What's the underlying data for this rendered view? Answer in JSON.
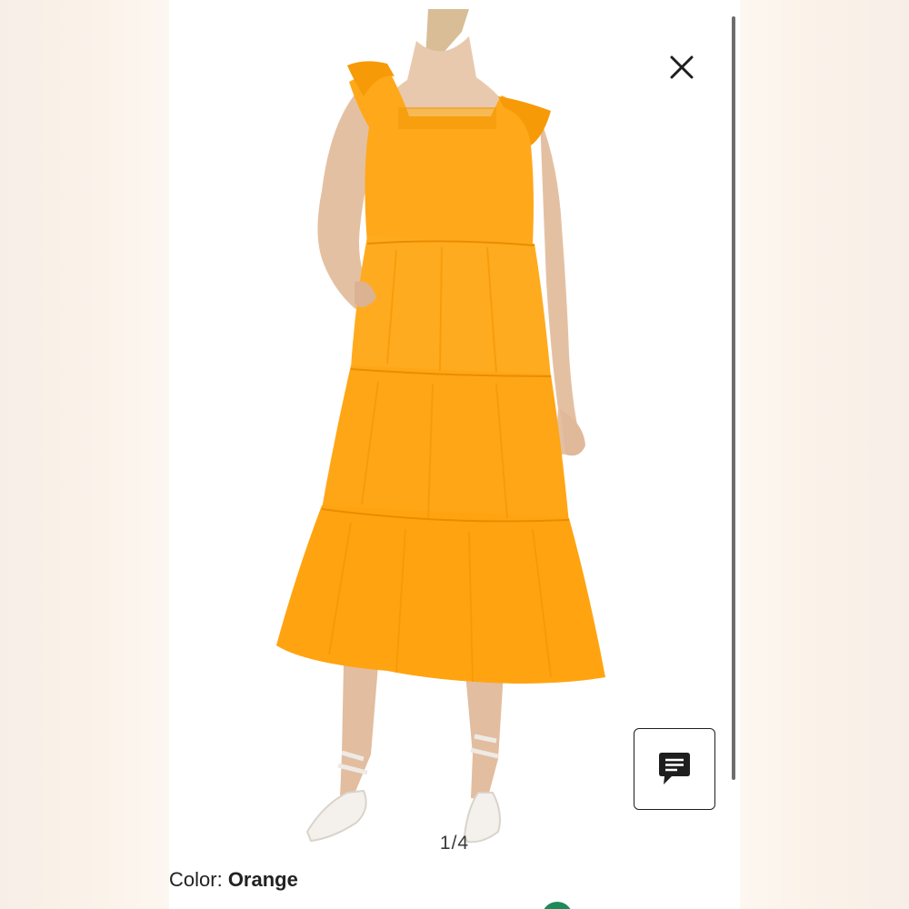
{
  "viewer": {
    "pager": {
      "current": "1",
      "separator": "/",
      "total": "4"
    },
    "color": {
      "label": "Color:",
      "value": "Orange"
    }
  },
  "icons": {
    "close": "close-icon",
    "chat": "chat-bubble-icon"
  },
  "colors": {
    "dress": "#FFA514",
    "accent_green": "#1E8A5A",
    "icon_dark": "#1E1E1E"
  }
}
